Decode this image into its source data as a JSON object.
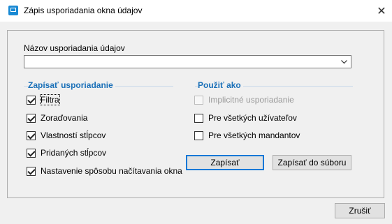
{
  "window": {
    "title": "Zápis usporiadania okna údajov",
    "close_glyph": "✕"
  },
  "name_field": {
    "label": "Názov usporiadania údajov",
    "value": ""
  },
  "save_group": {
    "title": "Zapísať usporiadanie",
    "items": [
      {
        "label": "Filtra",
        "checked": true
      },
      {
        "label": "Zoraďovania",
        "checked": true
      },
      {
        "label": "Vlastností stĺpcov",
        "checked": true
      },
      {
        "label": "Pridaných stĺpcov",
        "checked": true
      },
      {
        "label": "Nastavenie spôsobu načítavania okna",
        "checked": true
      }
    ]
  },
  "use_group": {
    "title": "Použiť ako",
    "items": [
      {
        "label": "Implicitné usporiadanie",
        "checked": false,
        "disabled": true
      },
      {
        "label": "Pre všetkých užívateľov",
        "checked": false,
        "disabled": false
      },
      {
        "label": "Pre všetkých mandantov",
        "checked": false,
        "disabled": false
      }
    ]
  },
  "buttons": {
    "save": "Zapísať",
    "save_to_file": "Zapísať do súboru",
    "cancel": "Zrušiť"
  },
  "icons": {
    "app": "window-app-icon",
    "close": "close-icon",
    "dropdown": "chevron-down-icon"
  },
  "colors": {
    "group_title": "#1a70b8",
    "default_button_border": "#0078d7"
  }
}
